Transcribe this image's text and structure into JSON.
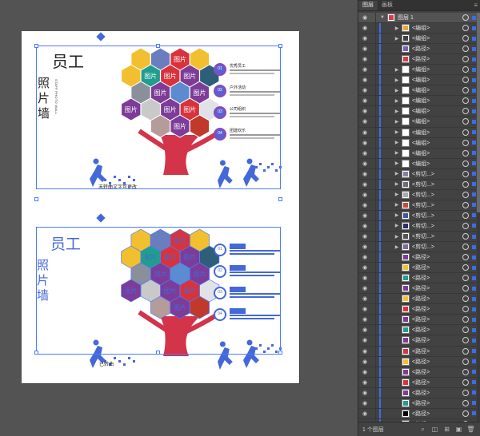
{
  "canvas": {
    "caption_top": "末转曲文字可更改",
    "caption_bottom": "已转曲",
    "tree": {
      "title_cn": [
        "员",
        "工",
        "照",
        "片",
        "墙"
      ],
      "title_en": "STAFF PHOTO WALL",
      "hex_photo_label": "图片",
      "legend_items": [
        {
          "num": "01",
          "title": "优秀员工"
        },
        {
          "num": "02",
          "title": "户外活动"
        },
        {
          "num": "03",
          "title": "公司组织"
        },
        {
          "num": "04",
          "title": "团建欢乐"
        }
      ]
    },
    "colors": {
      "hex_yellow": "#f2bf2e",
      "hex_red": "#d8333c",
      "hex_purple": "#7d3c98",
      "hex_teal": "#1f9e8e",
      "tree_red": "#d3344a",
      "runner_blue": "#4468d8",
      "selection_blue": "#4a7cff"
    }
  },
  "panel": {
    "tabs": [
      "图层",
      "画板"
    ],
    "top_layer": "图层 1",
    "rows": [
      {
        "label": "<编组>",
        "thumb": "#e6a43a",
        "twisty": true
      },
      {
        "label": "<编组>",
        "thumb": "#444",
        "twisty": true
      },
      {
        "label": "<路径>",
        "thumb": "#7b5fb3",
        "twisty": false
      },
      {
        "label": "<路径>",
        "thumb": "#d83c4c",
        "twisty": false
      },
      {
        "label": "<编组>",
        "thumb": "#ffffff",
        "twisty": true
      },
      {
        "label": "<编组>",
        "thumb": "#ffffff",
        "twisty": true
      },
      {
        "label": "<编组>",
        "thumb": "#ffffff",
        "twisty": true
      },
      {
        "label": "<编组>",
        "thumb": "#ffffff",
        "twisty": true
      },
      {
        "label": "<编组>",
        "thumb": "#ffffff",
        "twisty": true
      },
      {
        "label": "<编组>",
        "thumb": "#ffffff",
        "twisty": true
      },
      {
        "label": "<编组>",
        "thumb": "#ffffff",
        "twisty": true
      },
      {
        "label": "<编组>",
        "thumb": "#ffffff",
        "twisty": true
      },
      {
        "label": "<编组>",
        "thumb": "#ffffff",
        "twisty": true
      },
      {
        "label": "<编组>",
        "thumb": "#ffffff",
        "twisty": true
      },
      {
        "label": "<剪切...>",
        "thumb": "#8a7fa0",
        "twisty": true
      },
      {
        "label": "<剪切...>",
        "thumb": "#6f6a7a",
        "twisty": true
      },
      {
        "label": "<剪切...>",
        "thumb": "#aaa",
        "twisty": true
      },
      {
        "label": "<剪切...>",
        "thumb": "#c84a3a",
        "twisty": true
      },
      {
        "label": "<剪切...>",
        "thumb": "#3e5a9a",
        "twisty": true
      },
      {
        "label": "<剪切...>",
        "thumb": "#2d2d6a",
        "twisty": true
      },
      {
        "label": "<剪切...>",
        "thumb": "#555",
        "twisty": true
      },
      {
        "label": "<剪切...>",
        "thumb": "#7a6aa0",
        "twisty": true
      },
      {
        "label": "<路径>",
        "thumb": "#7d3c98",
        "twisty": false
      },
      {
        "label": "<路径>",
        "thumb": "#f2bf2e",
        "twisty": false
      },
      {
        "label": "<路径>",
        "thumb": "#1f9e8e",
        "twisty": false
      },
      {
        "label": "<路径>",
        "thumb": "#7d3c98",
        "twisty": false
      },
      {
        "label": "<路径>",
        "thumb": "#f2bf2e",
        "twisty": false
      },
      {
        "label": "<路径>",
        "thumb": "#d8333c",
        "twisty": false
      },
      {
        "label": "<路径>",
        "thumb": "#7d3c98",
        "twisty": false
      },
      {
        "label": "<路径>",
        "thumb": "#1f9e8e",
        "twisty": false
      },
      {
        "label": "<路径>",
        "thumb": "#7d3c98",
        "twisty": false
      },
      {
        "label": "<路径>",
        "thumb": "#d3344a",
        "twisty": false
      },
      {
        "label": "<路径>",
        "thumb": "#f2bf2e",
        "twisty": false
      },
      {
        "label": "<路径>",
        "thumb": "#7d3c98",
        "twisty": false
      },
      {
        "label": "<路径>",
        "thumb": "#d8333c",
        "twisty": false
      },
      {
        "label": "<路径>",
        "thumb": "#7d3c98",
        "twisty": false
      },
      {
        "label": "<路径>",
        "thumb": "#1f9e8e",
        "twisty": false
      },
      {
        "label": "<路径>",
        "thumb": "#000000",
        "twisty": false
      },
      {
        "label": "<编组>",
        "thumb": "#ffffff",
        "twisty": true
      }
    ],
    "footer_text": "1 个图层"
  }
}
